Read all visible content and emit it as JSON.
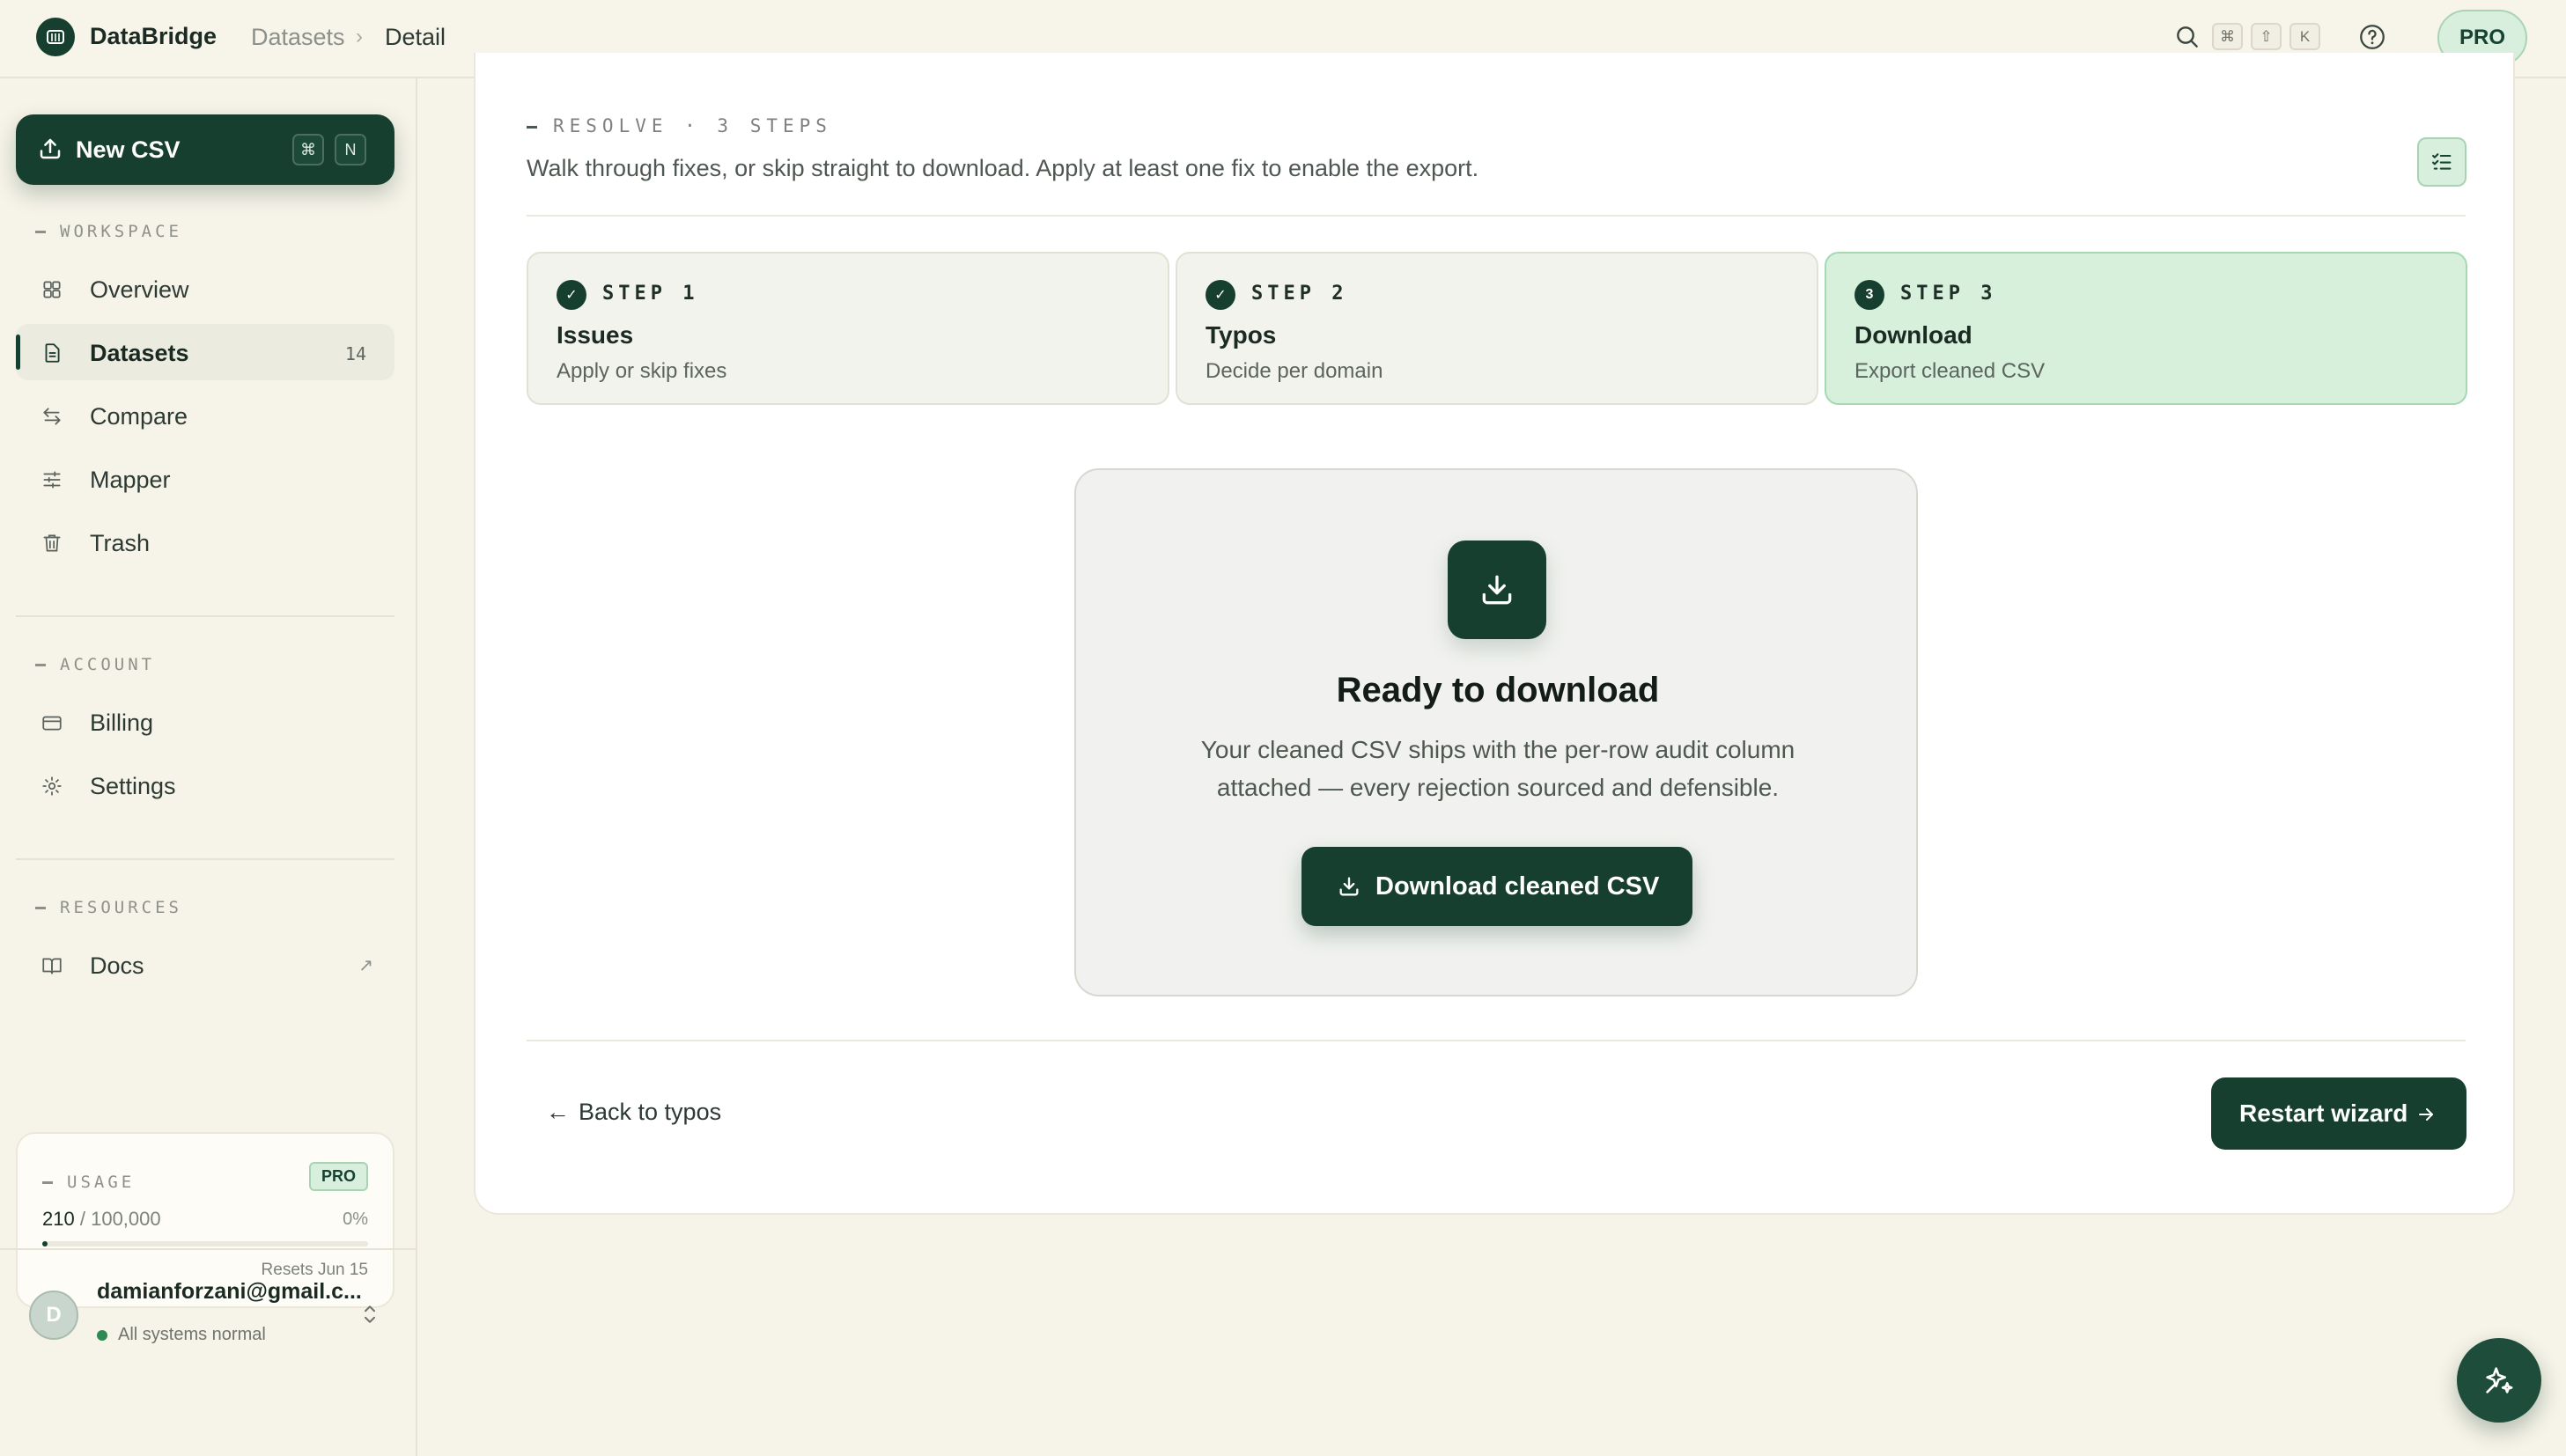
{
  "app": {
    "name": "DataBridge",
    "breadcrumb": [
      "Datasets",
      "Detail"
    ],
    "shortcut_keys": [
      "⌘",
      "⇧",
      "K"
    ],
    "plan_badge": "PRO"
  },
  "sidebar": {
    "new_csv": {
      "label": "New CSV",
      "keys": [
        "⌘",
        "N"
      ]
    },
    "workspace_heading": "WORKSPACE",
    "workspace_items": [
      {
        "label": "Overview",
        "icon": "grid-icon"
      },
      {
        "label": "Datasets",
        "icon": "file-icon",
        "count": "14",
        "active": true
      },
      {
        "label": "Compare",
        "icon": "arrows-icon"
      },
      {
        "label": "Mapper",
        "icon": "sliders-icon"
      },
      {
        "label": "Trash",
        "icon": "trash-icon"
      }
    ],
    "account_heading": "ACCOUNT",
    "account_items": [
      {
        "label": "Billing",
        "icon": "card-icon"
      },
      {
        "label": "Settings",
        "icon": "gear-icon"
      }
    ],
    "resources_heading": "RESOURCES",
    "resources_items": [
      {
        "label": "Docs",
        "icon": "book-icon",
        "external": "↗"
      }
    ],
    "usage": {
      "heading": "USAGE",
      "badge": "PRO",
      "used": "210",
      "separator": "/",
      "limit": "100,000",
      "percent": "0%",
      "fill_fraction": 0.0021,
      "reset": "Resets Jun 15"
    },
    "user": {
      "initial": "D",
      "email": "damianforzani@gmail.c...",
      "status": "All systems normal"
    }
  },
  "resolve": {
    "heading": "RESOLVE · 3 STEPS",
    "description": "Walk through fixes, or skip straight to download. Apply at least one fix to enable the export.",
    "steps": [
      {
        "marker": "✓",
        "tag": "STEP 1",
        "title": "Issues",
        "subtitle": "Apply or skip fixes",
        "state": "done"
      },
      {
        "marker": "✓",
        "tag": "STEP 2",
        "title": "Typos",
        "subtitle": "Decide per domain",
        "state": "done"
      },
      {
        "marker": "3",
        "tag": "STEP 3",
        "title": "Download",
        "subtitle": "Export cleaned CSV",
        "state": "current"
      }
    ]
  },
  "download": {
    "title": "Ready to download",
    "description": "Your cleaned CSV ships with the per-row audit column attached — every rejection sourced and defensible.",
    "button": "Download cleaned CSV"
  },
  "footer": {
    "back": "Back to typos",
    "back_arrow": "←",
    "restart": "Restart wizard"
  },
  "colors": {
    "accent": "#173f2f",
    "accent_soft": "#d6f0dc",
    "background": "#f6f3e8",
    "status_ok": "#2e8a55"
  }
}
